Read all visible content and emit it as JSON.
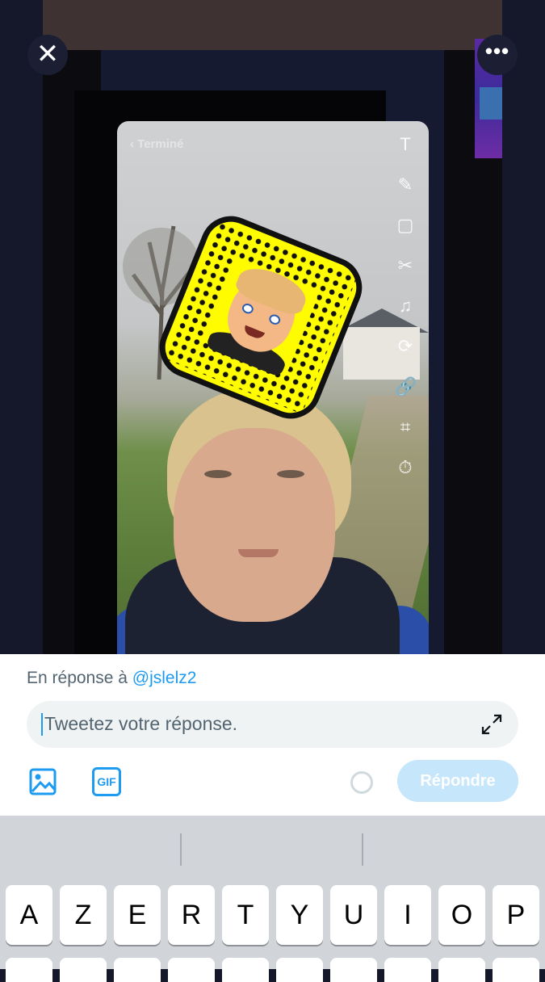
{
  "viewer": {
    "close_label": "✕",
    "more_label": "•••",
    "snap": {
      "back_label": "‹ Terminé",
      "tools": [
        "T",
        "✎",
        "▢",
        "✂",
        "♫",
        "⟳",
        "🔗",
        "⌗",
        "⏱"
      ]
    }
  },
  "reply": {
    "prefix": "En réponse à ",
    "handle": "@jslelz2",
    "input_placeholder": "Tweetez votre réponse.",
    "gif_label": "GIF",
    "submit_label": "Répondre"
  },
  "keyboard": {
    "row1": [
      "A",
      "Z",
      "E",
      "R",
      "T",
      "Y",
      "U",
      "I",
      "O",
      "P"
    ]
  },
  "colors": {
    "accent": "#1d9bf0",
    "submit_disabled": "#c6e6fc",
    "snap_yellow": "#fffc00"
  }
}
